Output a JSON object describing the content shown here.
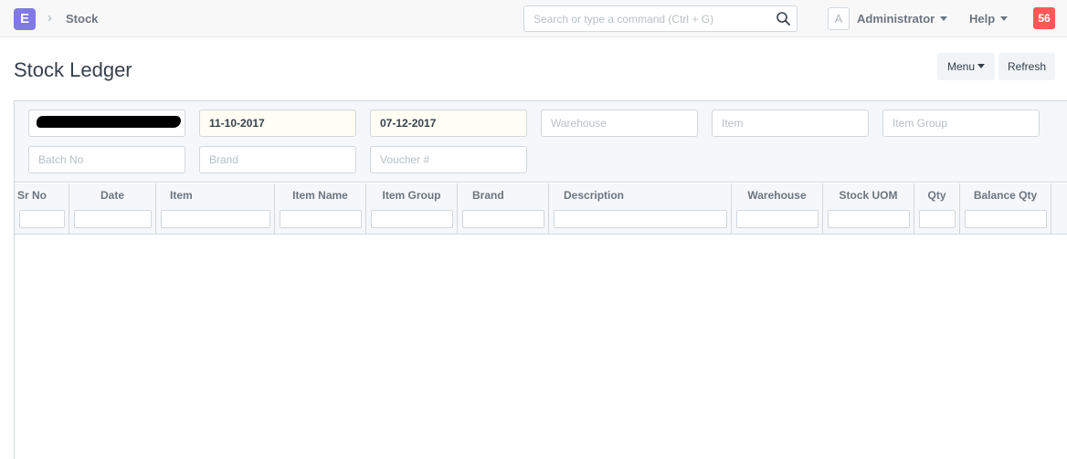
{
  "navbar": {
    "logo_letter": "E",
    "breadcrumb": "Stock",
    "search_placeholder": "Search or type a command (Ctrl + G)",
    "avatar_letter": "A",
    "user_label": "Administrator",
    "help_label": "Help",
    "notification_count": "56"
  },
  "page": {
    "title": "Stock Ledger",
    "menu_label": "Menu",
    "refresh_label": "Refresh"
  },
  "filters": {
    "company": "",
    "from_date": "11-10-2017",
    "to_date": "07-12-2017",
    "warehouse_placeholder": "Warehouse",
    "item_placeholder": "Item",
    "item_group_placeholder": "Item Group",
    "batch_no_placeholder": "Batch No",
    "brand_placeholder": "Brand",
    "voucher_placeholder": "Voucher #"
  },
  "grid": {
    "columns": [
      "Sr No",
      "Date",
      "Item",
      "Item Name",
      "Item Group",
      "Brand",
      "Description",
      "Warehouse",
      "Stock UOM",
      "Qty",
      "Balance Qty"
    ]
  },
  "colors": {
    "logo_bg": "#8079e6",
    "notification_bg": "#ff5858",
    "date_field_bg": "#fffdf4",
    "filter_area_bg": "#f5f7fa"
  }
}
